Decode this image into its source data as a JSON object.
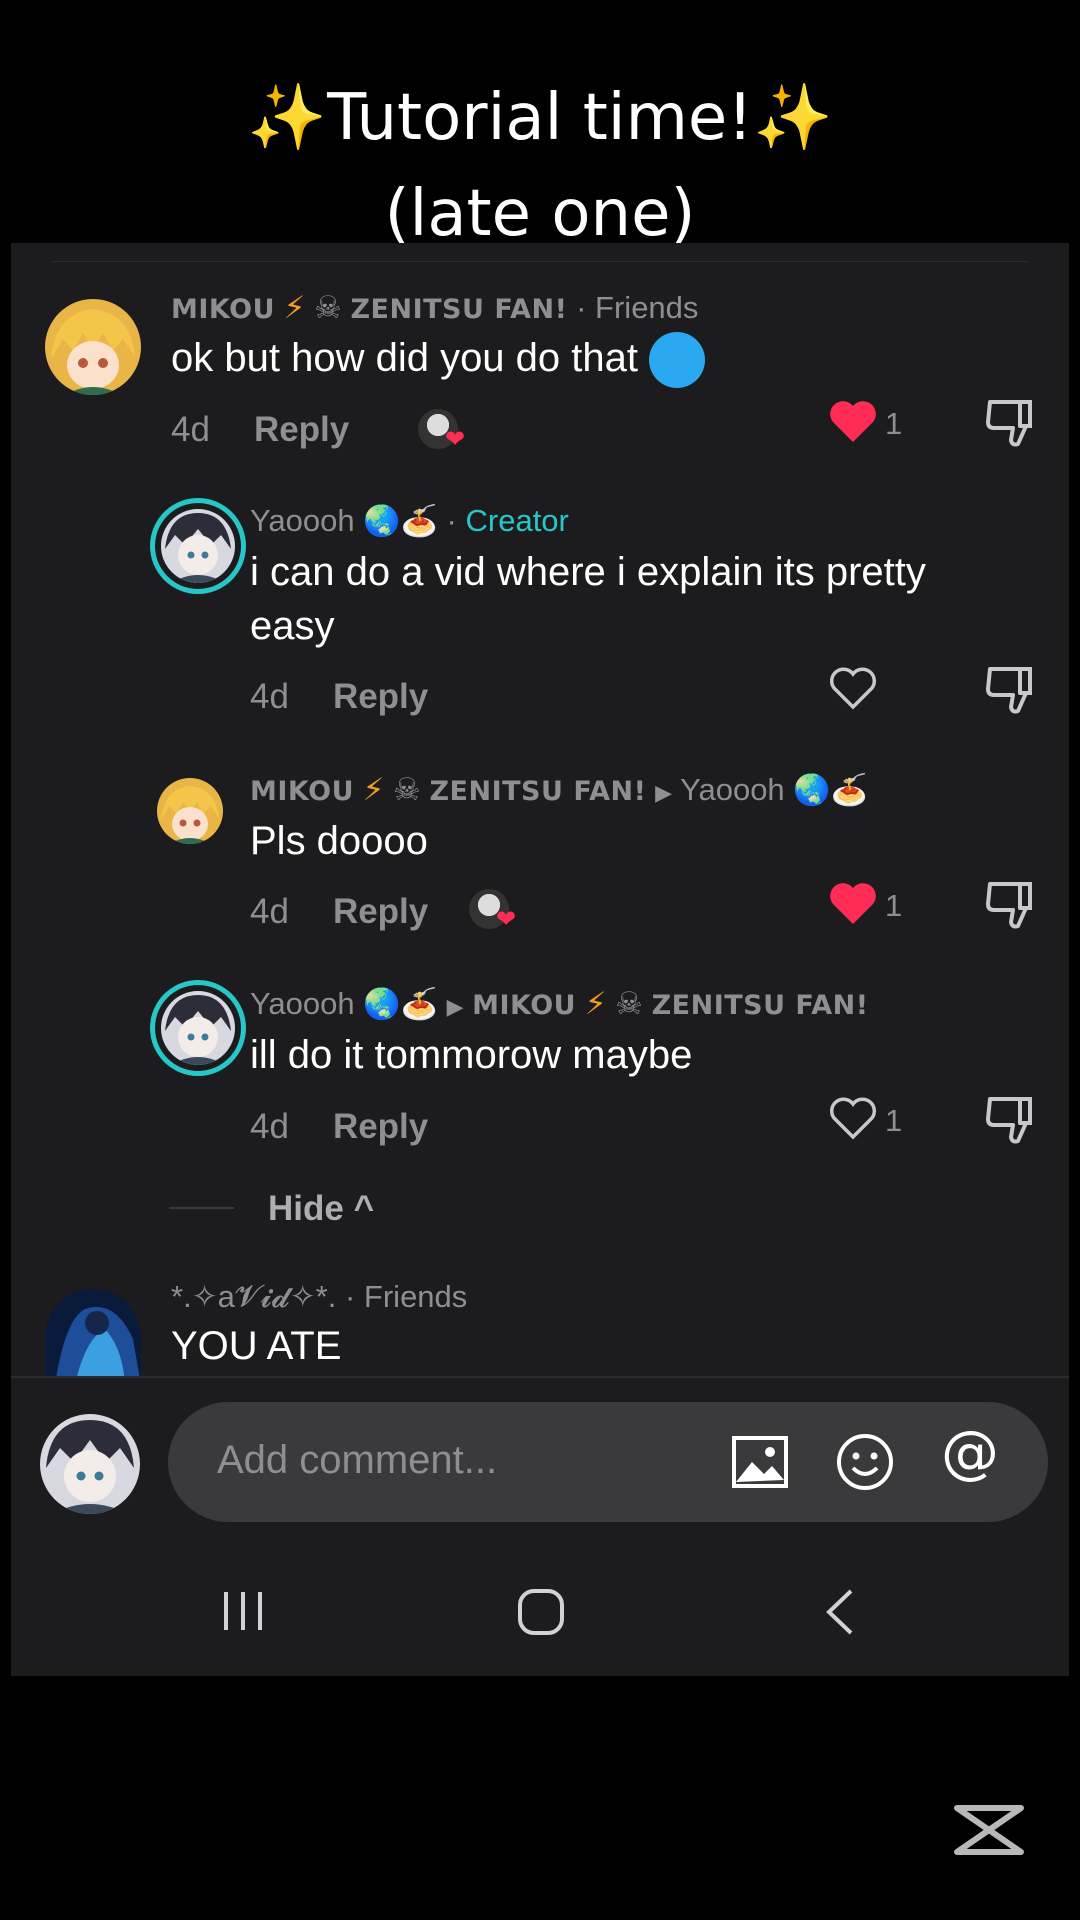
{
  "caption": {
    "line1": "✨Tutorial time!✨",
    "line2": "(late one)"
  },
  "comments": [
    {
      "username_sc": "mikou",
      "username_rest": "zenitsu fan!",
      "separator": " · ",
      "tag": "Friends",
      "text": "ok but how did you do that",
      "text_emoji": "😥",
      "age": "4d",
      "reply_label": "Reply",
      "liked": true,
      "like_count": "1"
    },
    {
      "username": "Yaoooh",
      "username_emoji": "🌏🍝",
      "separator": " · ",
      "tag": "Creator",
      "text": "i can do a vid where i explain its pretty easy",
      "age": "4d",
      "reply_label": "Reply",
      "liked": false,
      "like_count": ""
    },
    {
      "username_sc": "mikou",
      "username_rest": "zenitsu fan!",
      "reply_to": "Yaoooh",
      "reply_to_emoji": "🌏🍝",
      "text": "Pls doooo",
      "age": "4d",
      "reply_label": "Reply",
      "liked": true,
      "like_count": "1"
    },
    {
      "username": "Yaoooh",
      "username_emoji": "🌏🍝",
      "reply_to_sc": "mikou",
      "reply_to_rest": "zenitsu fan!",
      "text": "ill do it tommorow maybe",
      "age": "4d",
      "reply_label": "Reply",
      "liked": false,
      "like_count": "1"
    },
    {
      "username": "*.✧a𝓥𝓲𝓭✧*.",
      "separator": " · ",
      "tag": "Friends",
      "text": "YOU ATE"
    }
  ],
  "hide_label": "Hide ^",
  "composer": {
    "placeholder": "Add comment...",
    "icons": [
      "image-icon",
      "emoji-icon",
      "mention-icon"
    ],
    "mention_symbol": "@"
  },
  "nav": [
    "recent-apps-icon",
    "home-icon",
    "back-icon"
  ],
  "colors": {
    "background": "#1c1c1e",
    "creator": "#27c7c9",
    "heart": "#ff2d55",
    "muted": "#8e8e93"
  }
}
